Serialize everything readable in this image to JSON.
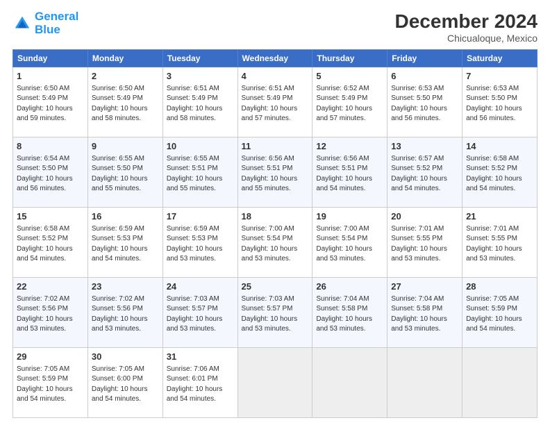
{
  "header": {
    "logo_line1": "General",
    "logo_line2": "Blue",
    "main_title": "December 2024",
    "subtitle": "Chicualoque, Mexico"
  },
  "days_of_week": [
    "Sunday",
    "Monday",
    "Tuesday",
    "Wednesday",
    "Thursday",
    "Friday",
    "Saturday"
  ],
  "weeks": [
    [
      {
        "day": 1,
        "lines": [
          "Sunrise: 6:50 AM",
          "Sunset: 5:49 PM",
          "Daylight: 10 hours",
          "and 59 minutes."
        ]
      },
      {
        "day": 2,
        "lines": [
          "Sunrise: 6:50 AM",
          "Sunset: 5:49 PM",
          "Daylight: 10 hours",
          "and 58 minutes."
        ]
      },
      {
        "day": 3,
        "lines": [
          "Sunrise: 6:51 AM",
          "Sunset: 5:49 PM",
          "Daylight: 10 hours",
          "and 58 minutes."
        ]
      },
      {
        "day": 4,
        "lines": [
          "Sunrise: 6:51 AM",
          "Sunset: 5:49 PM",
          "Daylight: 10 hours",
          "and 57 minutes."
        ]
      },
      {
        "day": 5,
        "lines": [
          "Sunrise: 6:52 AM",
          "Sunset: 5:49 PM",
          "Daylight: 10 hours",
          "and 57 minutes."
        ]
      },
      {
        "day": 6,
        "lines": [
          "Sunrise: 6:53 AM",
          "Sunset: 5:50 PM",
          "Daylight: 10 hours",
          "and 56 minutes."
        ]
      },
      {
        "day": 7,
        "lines": [
          "Sunrise: 6:53 AM",
          "Sunset: 5:50 PM",
          "Daylight: 10 hours",
          "and 56 minutes."
        ]
      }
    ],
    [
      {
        "day": 8,
        "lines": [
          "Sunrise: 6:54 AM",
          "Sunset: 5:50 PM",
          "Daylight: 10 hours",
          "and 56 minutes."
        ]
      },
      {
        "day": 9,
        "lines": [
          "Sunrise: 6:55 AM",
          "Sunset: 5:50 PM",
          "Daylight: 10 hours",
          "and 55 minutes."
        ]
      },
      {
        "day": 10,
        "lines": [
          "Sunrise: 6:55 AM",
          "Sunset: 5:51 PM",
          "Daylight: 10 hours",
          "and 55 minutes."
        ]
      },
      {
        "day": 11,
        "lines": [
          "Sunrise: 6:56 AM",
          "Sunset: 5:51 PM",
          "Daylight: 10 hours",
          "and 55 minutes."
        ]
      },
      {
        "day": 12,
        "lines": [
          "Sunrise: 6:56 AM",
          "Sunset: 5:51 PM",
          "Daylight: 10 hours",
          "and 54 minutes."
        ]
      },
      {
        "day": 13,
        "lines": [
          "Sunrise: 6:57 AM",
          "Sunset: 5:52 PM",
          "Daylight: 10 hours",
          "and 54 minutes."
        ]
      },
      {
        "day": 14,
        "lines": [
          "Sunrise: 6:58 AM",
          "Sunset: 5:52 PM",
          "Daylight: 10 hours",
          "and 54 minutes."
        ]
      }
    ],
    [
      {
        "day": 15,
        "lines": [
          "Sunrise: 6:58 AM",
          "Sunset: 5:52 PM",
          "Daylight: 10 hours",
          "and 54 minutes."
        ]
      },
      {
        "day": 16,
        "lines": [
          "Sunrise: 6:59 AM",
          "Sunset: 5:53 PM",
          "Daylight: 10 hours",
          "and 54 minutes."
        ]
      },
      {
        "day": 17,
        "lines": [
          "Sunrise: 6:59 AM",
          "Sunset: 5:53 PM",
          "Daylight: 10 hours",
          "and 53 minutes."
        ]
      },
      {
        "day": 18,
        "lines": [
          "Sunrise: 7:00 AM",
          "Sunset: 5:54 PM",
          "Daylight: 10 hours",
          "and 53 minutes."
        ]
      },
      {
        "day": 19,
        "lines": [
          "Sunrise: 7:00 AM",
          "Sunset: 5:54 PM",
          "Daylight: 10 hours",
          "and 53 minutes."
        ]
      },
      {
        "day": 20,
        "lines": [
          "Sunrise: 7:01 AM",
          "Sunset: 5:55 PM",
          "Daylight: 10 hours",
          "and 53 minutes."
        ]
      },
      {
        "day": 21,
        "lines": [
          "Sunrise: 7:01 AM",
          "Sunset: 5:55 PM",
          "Daylight: 10 hours",
          "and 53 minutes."
        ]
      }
    ],
    [
      {
        "day": 22,
        "lines": [
          "Sunrise: 7:02 AM",
          "Sunset: 5:56 PM",
          "Daylight: 10 hours",
          "and 53 minutes."
        ]
      },
      {
        "day": 23,
        "lines": [
          "Sunrise: 7:02 AM",
          "Sunset: 5:56 PM",
          "Daylight: 10 hours",
          "and 53 minutes."
        ]
      },
      {
        "day": 24,
        "lines": [
          "Sunrise: 7:03 AM",
          "Sunset: 5:57 PM",
          "Daylight: 10 hours",
          "and 53 minutes."
        ]
      },
      {
        "day": 25,
        "lines": [
          "Sunrise: 7:03 AM",
          "Sunset: 5:57 PM",
          "Daylight: 10 hours",
          "and 53 minutes."
        ]
      },
      {
        "day": 26,
        "lines": [
          "Sunrise: 7:04 AM",
          "Sunset: 5:58 PM",
          "Daylight: 10 hours",
          "and 53 minutes."
        ]
      },
      {
        "day": 27,
        "lines": [
          "Sunrise: 7:04 AM",
          "Sunset: 5:58 PM",
          "Daylight: 10 hours",
          "and 53 minutes."
        ]
      },
      {
        "day": 28,
        "lines": [
          "Sunrise: 7:05 AM",
          "Sunset: 5:59 PM",
          "Daylight: 10 hours",
          "and 54 minutes."
        ]
      }
    ],
    [
      {
        "day": 29,
        "lines": [
          "Sunrise: 7:05 AM",
          "Sunset: 5:59 PM",
          "Daylight: 10 hours",
          "and 54 minutes."
        ]
      },
      {
        "day": 30,
        "lines": [
          "Sunrise: 7:05 AM",
          "Sunset: 6:00 PM",
          "Daylight: 10 hours",
          "and 54 minutes."
        ]
      },
      {
        "day": 31,
        "lines": [
          "Sunrise: 7:06 AM",
          "Sunset: 6:01 PM",
          "Daylight: 10 hours",
          "and 54 minutes."
        ]
      },
      null,
      null,
      null,
      null
    ]
  ]
}
